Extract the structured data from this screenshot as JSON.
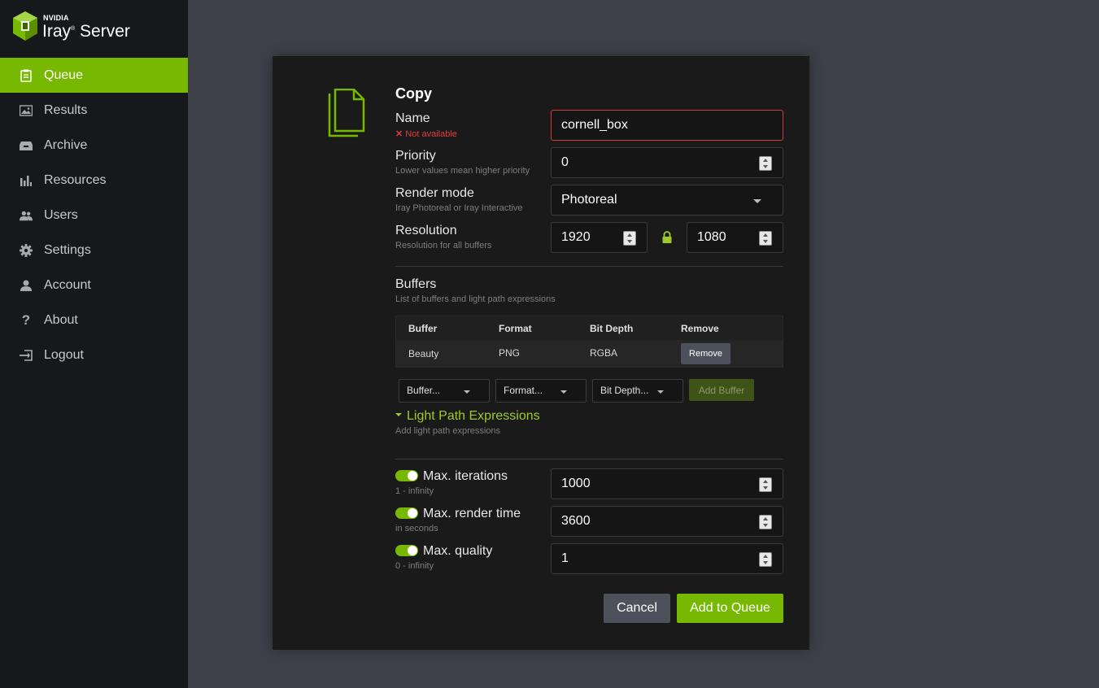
{
  "brand": {
    "company": "NVIDIA",
    "product": "Iray",
    "suffix": "Server",
    "accent": "#76b900"
  },
  "sidebar": {
    "items": [
      {
        "label": "Queue",
        "icon": "clipboard-icon",
        "active": true
      },
      {
        "label": "Results",
        "icon": "image-icon"
      },
      {
        "label": "Archive",
        "icon": "archive-box-icon"
      },
      {
        "label": "Resources",
        "icon": "bar-chart-icon"
      },
      {
        "label": "Users",
        "icon": "users-icon"
      },
      {
        "label": "Settings",
        "icon": "gear-icon"
      },
      {
        "label": "Account",
        "icon": "user-icon"
      },
      {
        "label": "About",
        "icon": "question-icon"
      },
      {
        "label": "Logout",
        "icon": "logout-icon"
      }
    ]
  },
  "dialog": {
    "title": "Copy",
    "name": {
      "label": "Name",
      "error": "Not available",
      "value": "cornell_box"
    },
    "priority": {
      "label": "Priority",
      "hint": "Lower values mean higher priority",
      "value": "0"
    },
    "render_mode": {
      "label": "Render mode",
      "hint": "Iray Photoreal or Iray Interactive",
      "value": "Photoreal"
    },
    "resolution": {
      "label": "Resolution",
      "hint": "Resolution for all buffers",
      "width": "1920",
      "height": "1080"
    },
    "buffers": {
      "label": "Buffers",
      "hint": "List of buffers and light path expressions",
      "columns": [
        "Buffer",
        "Format",
        "Bit Depth",
        "Remove"
      ],
      "rows": [
        {
          "buffer": "Beauty",
          "format": "PNG",
          "bit_depth": "RGBA",
          "remove": "Remove"
        }
      ],
      "buffer_select": "Buffer...",
      "format_select": "Format...",
      "bitdepth_select": "Bit Depth...",
      "add_button": "Add Buffer"
    },
    "lpe": {
      "label": "Light Path Expressions",
      "hint": "Add light path expressions"
    },
    "max_iterations": {
      "label": "Max. iterations",
      "hint": "1 - infinity",
      "value": "1000",
      "enabled": true
    },
    "max_render_time": {
      "label": "Max. render time",
      "hint": "in seconds",
      "value": "3600",
      "enabled": true
    },
    "max_quality": {
      "label": "Max. quality",
      "hint": "0 - infinity",
      "value": "1",
      "enabled": true
    },
    "cancel": "Cancel",
    "submit": "Add to Queue"
  }
}
